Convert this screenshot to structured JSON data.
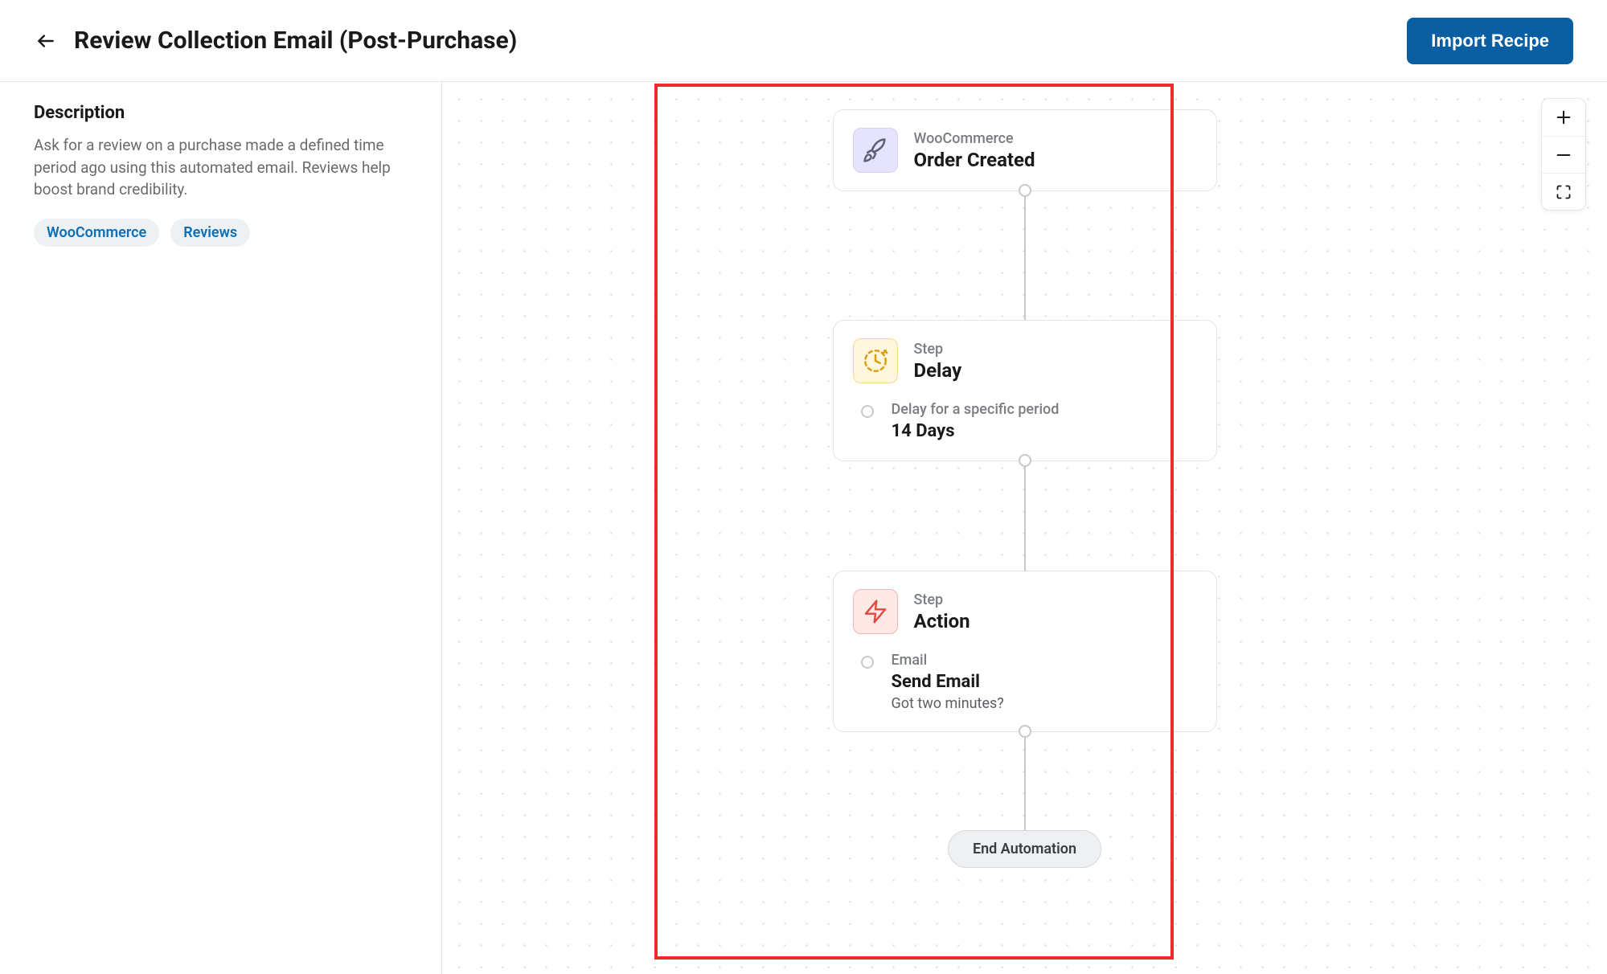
{
  "header": {
    "title": "Review Collection Email (Post-Purchase)",
    "import_label": "Import Recipe"
  },
  "sidebar": {
    "desc_heading": "Description",
    "desc_text": "Ask for a review on a purchase made a defined time period ago using this automated email. Reviews help boost brand credibility.",
    "tags": [
      "WooCommerce",
      "Reviews"
    ]
  },
  "flow": {
    "trigger": {
      "eyebrow": "WooCommerce",
      "title": "Order Created"
    },
    "delay": {
      "eyebrow": "Step",
      "title": "Delay",
      "sub_label": "Delay for a specific period",
      "sub_value": "14 Days"
    },
    "action": {
      "eyebrow": "Step",
      "title": "Action",
      "sub_label": "Email",
      "sub_value": "Send Email",
      "sub_extra": "Got two minutes?"
    },
    "end_label": "End Automation"
  }
}
